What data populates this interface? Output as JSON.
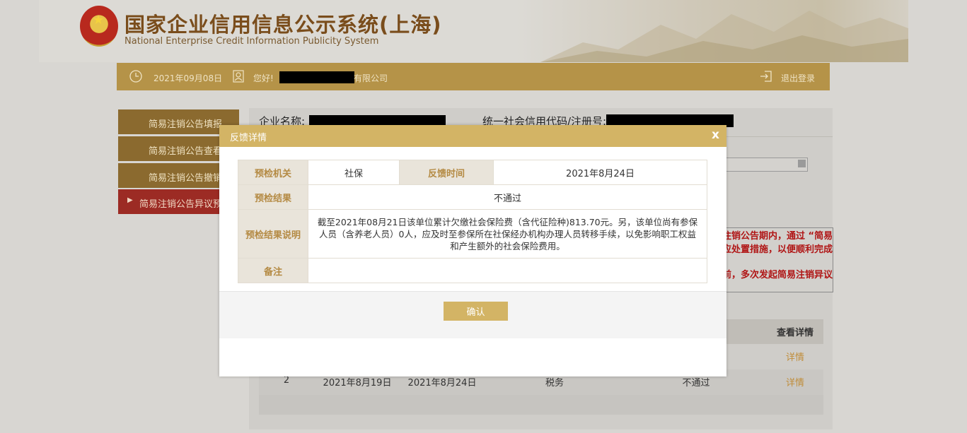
{
  "header": {
    "title_cn": "国家企业信用信息公示系统(上海)",
    "title_en": "National Enterprise Credit Information Publicity System"
  },
  "topbar": {
    "date": "2021年09月08日",
    "greeting": "您好!",
    "company_suffix": "有限公司",
    "logout": "退出登录"
  },
  "menu": [
    {
      "label": "简易注销公告填报"
    },
    {
      "label": "简易注销公告查看"
    },
    {
      "label": "简易注销公告撤销"
    },
    {
      "label": "简易注销公告异议预检"
    }
  ],
  "main": {
    "company_label": "企业名称:",
    "credit_code_label": "统一社会信用代码/注册号:",
    "notice_lines": [
      "注销公告期内，通过 “简易",
      "应处置措施，以便顺利完成",
      "",
      "前，多次发起简易注销异议"
    ],
    "table_headers": {
      "detail": "查看详情"
    },
    "rows": [
      {
        "no": "",
        "date1": "",
        "date2": "",
        "org": "",
        "result": "",
        "detail": "详情"
      },
      {
        "no": "2",
        "date1": "2021年8月19日",
        "date2": "2021年8月24日",
        "org": "税务",
        "result": "不通过",
        "detail": "详情"
      }
    ]
  },
  "modal": {
    "title": "反馈详情",
    "close": "x",
    "labels": {
      "agency": "预检机关",
      "feedback_time": "反馈时间",
      "result": "预检结果",
      "result_desc": "预检结果说明",
      "remark": "备注"
    },
    "values": {
      "agency": "社保",
      "feedback_time": "2021年8月24日",
      "result": "不通过",
      "result_desc": "截至2021年08月21日该单位累计欠缴社会保险费（含代征险种)813.70元。另，该单位尚有参保人员（含养老人员）0人，应及时至参保所在社保经办机构办理人员转移手续，以免影响职工权益和产生额外的社会保险费用。",
      "remark": ""
    },
    "confirm": "确认"
  }
}
